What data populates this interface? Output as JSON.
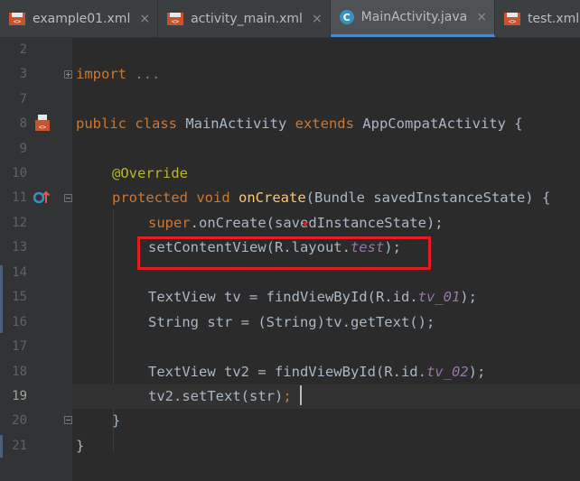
{
  "tabs": [
    {
      "label": "example01.xml",
      "type": "xml",
      "active": false
    },
    {
      "label": "activity_main.xml",
      "type": "xml",
      "active": false
    },
    {
      "label": "MainActivity.java",
      "type": "java",
      "active": true
    },
    {
      "label": "test.xml",
      "type": "xml",
      "active": false
    }
  ],
  "tab_close_glyph": "×",
  "java_icon_letter": "C",
  "current_line": 19,
  "lines": [
    {
      "num": "2"
    },
    {
      "num": "3"
    },
    {
      "num": "7"
    },
    {
      "num": "8"
    },
    {
      "num": "9"
    },
    {
      "num": "10"
    },
    {
      "num": "11"
    },
    {
      "num": "12"
    },
    {
      "num": "13"
    },
    {
      "num": "14"
    },
    {
      "num": "15"
    },
    {
      "num": "16"
    },
    {
      "num": "17"
    },
    {
      "num": "18"
    },
    {
      "num": "19"
    },
    {
      "num": "20"
    },
    {
      "num": "21"
    }
  ],
  "code": {
    "l3_kw": "import",
    "l3_rest": " ...",
    "l8_kw1": "public class",
    "l8_name": " MainActivity ",
    "l8_kw2": "extends",
    "l8_rest": " AppCompatActivity {",
    "l10_ann": "@Override",
    "l11_kw": "protected void",
    "l11_fn": "onCreate",
    "l11_rest": "(Bundle savedInstanceState) {",
    "l12_kw": "super",
    "l12_rest": ".onCreate(savedInstanceState);",
    "l13_pre": "setContentView(R.layout.",
    "l13_fld": "test",
    "l13_post": ");",
    "l15_pre": "TextView tv = findViewById(R.id.",
    "l15_fld": "tv_01",
    "l15_post": ");",
    "l16_text": "String str = (String)tv.getText();",
    "l18_pre": "TextView tv2 = findViewById(R.id.",
    "l18_fld": "tv_02",
    "l18_post": ");",
    "l19_pre": "tv2.setText(str)",
    "l19_post": ";",
    "l20_text": "}",
    "l21_text": "}"
  },
  "colors": {
    "background": "#2b2b2b",
    "keyword": "#cc7832",
    "annotation": "#bbb529",
    "method": "#ffc66d",
    "field": "#9876aa",
    "highlight_box": "#e51b24"
  }
}
